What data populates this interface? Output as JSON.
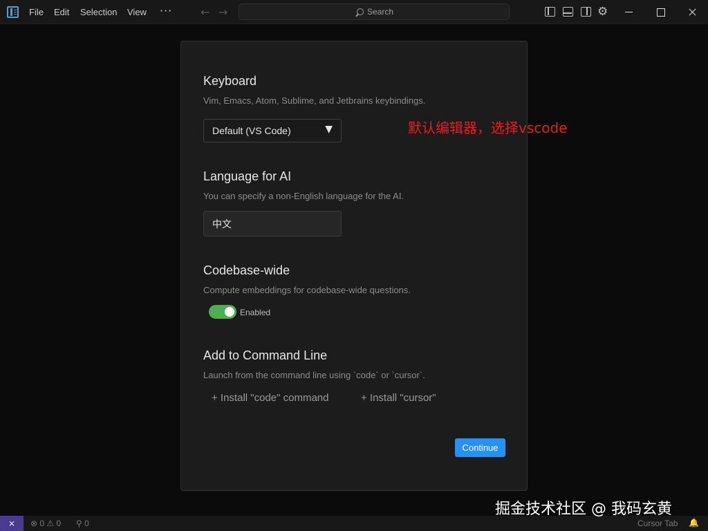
{
  "menu": {
    "file": "File",
    "edit": "Edit",
    "selection": "Selection",
    "view": "View",
    "more": "···"
  },
  "search": {
    "placeholder": "Search"
  },
  "dialog": {
    "keyboard": {
      "title": "Keyboard",
      "description": "Vim, Emacs, Atom, Sublime, and Jetbrains keybindings.",
      "selected": "Default (VS Code)",
      "caret": "▼"
    },
    "language": {
      "title": "Language for AI",
      "description": "You can specify a non-English language for the AI.",
      "value": "中文"
    },
    "codebase": {
      "title": "Codebase-wide",
      "description": "Compute embeddings for codebase-wide questions.",
      "toggle_label": "Enabled",
      "enabled": true
    },
    "command_line": {
      "title": "Add to Command Line",
      "description": "Launch from the command line using `code` or `cursor`.",
      "install_code": "+ Install \"code\" command",
      "install_cursor": "+ Install \"cursor\""
    },
    "continue_label": "Continue"
  },
  "annotation": "默认编辑器，选择vscode",
  "statusbar": {
    "remote_icon": "⨯",
    "problems": "⊗ 0 ⚠ 0",
    "ports": "⚲ 0",
    "cursor_tab": "Cursor Tab",
    "bell": "🔔"
  },
  "watermark": "掘金技术社区 @ 我码玄黄",
  "colors": {
    "accent": "#2b8ff0",
    "toggle_on": "#4caf50",
    "annotation": "#e02020",
    "remote": "#4b3b8f"
  }
}
